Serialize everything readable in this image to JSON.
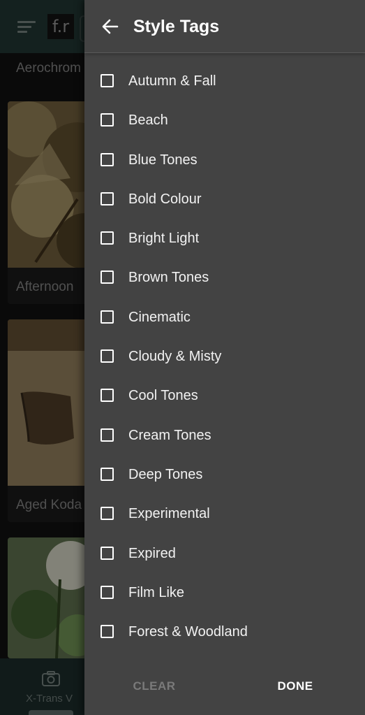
{
  "background": {
    "app_logo": "f.r",
    "cards": [
      {
        "title": "Aerochrom"
      },
      {
        "title": "Afternoon"
      },
      {
        "title": "Aged Koda"
      }
    ],
    "bottom_nav": {
      "label": "X-Trans V",
      "icon": "camera-icon"
    }
  },
  "drawer": {
    "title": "Style Tags",
    "back_icon": "arrow-left-icon",
    "tags": [
      {
        "label": "Autumn & Fall",
        "checked": false
      },
      {
        "label": "Beach",
        "checked": false
      },
      {
        "label": "Blue Tones",
        "checked": false
      },
      {
        "label": "Bold Colour",
        "checked": false
      },
      {
        "label": "Bright Light",
        "checked": false
      },
      {
        "label": "Brown Tones",
        "checked": false
      },
      {
        "label": "Cinematic",
        "checked": false
      },
      {
        "label": "Cloudy & Misty",
        "checked": false
      },
      {
        "label": "Cool Tones",
        "checked": false
      },
      {
        "label": "Cream Tones",
        "checked": false
      },
      {
        "label": "Deep Tones",
        "checked": false
      },
      {
        "label": "Experimental",
        "checked": false
      },
      {
        "label": "Expired",
        "checked": false
      },
      {
        "label": "Film Like",
        "checked": false
      },
      {
        "label": "Forest & Woodland",
        "checked": false
      }
    ],
    "footer": {
      "clear_label": "CLEAR",
      "done_label": "DONE"
    }
  },
  "colors": {
    "drawer_bg": "#434343",
    "header_bar": "#1f3430",
    "text_primary": "#ffffff",
    "text_disabled": "#7a7a7a"
  }
}
